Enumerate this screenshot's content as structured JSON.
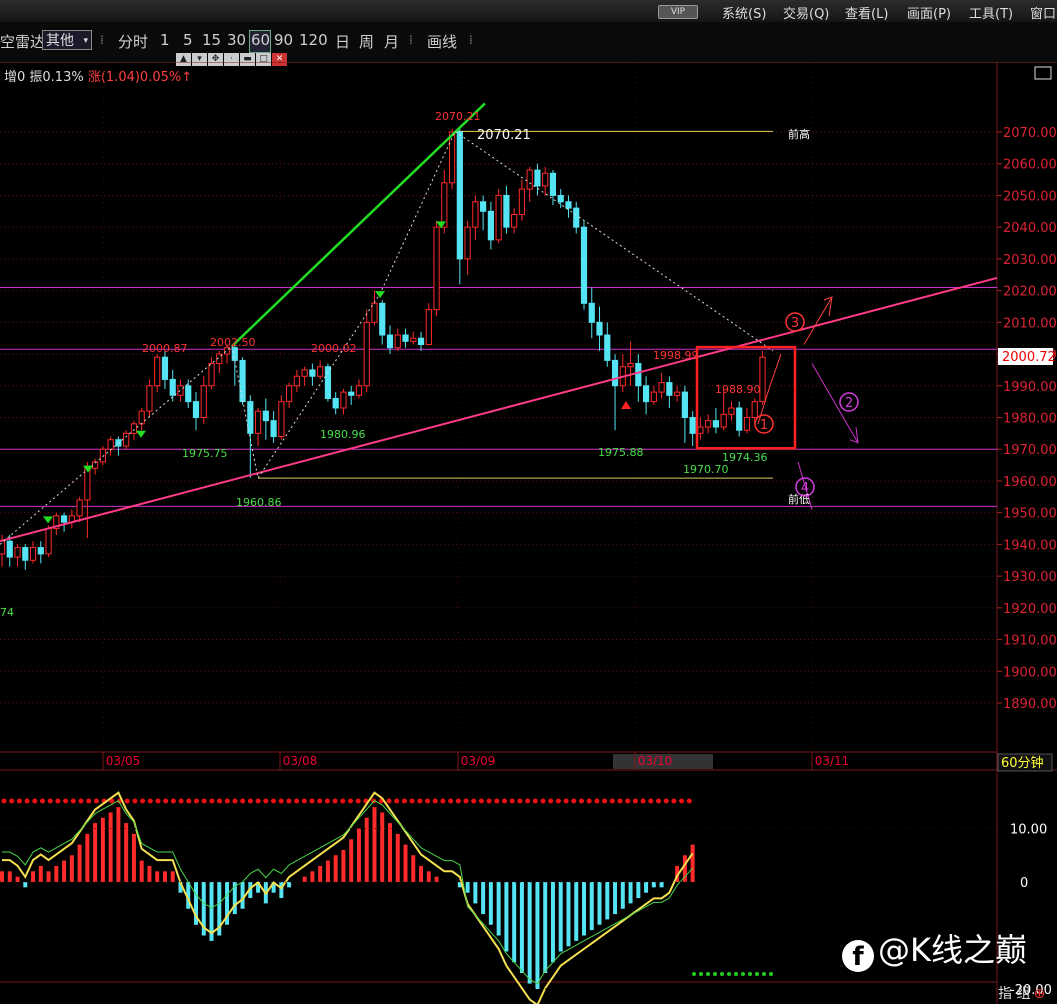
{
  "topbar": {
    "vip": "VIP",
    "menus": [
      "系统(S)",
      "交易(Q)",
      "查看(L)",
      "画面(P)",
      "工具(T)",
      "窗口"
    ]
  },
  "toolbar": {
    "left_label": "空雷达",
    "select_value": "其他",
    "periods": [
      "分时",
      "1",
      "5",
      "15",
      "30",
      "60",
      "90",
      "120",
      "日",
      "周",
      "月"
    ],
    "active_period": "60",
    "draw": "画线"
  },
  "info": {
    "part1": "增0 振0.13%",
    "part2": "涨(1.04)0.05%↑"
  },
  "current_price": "2000.72",
  "period_label": "60分钟",
  "indicator_label": "指 组",
  "brand": "@K线之巅",
  "colors": {
    "up": "#ff2a2a",
    "down": "#54e4f4",
    "trend_green": "#22dd22",
    "trend_pink": "#ff3a86",
    "level_purple": "#cc33cc",
    "box": "#ff2222"
  },
  "chart_data": [
    {
      "type": "candlestick",
      "ylim": [
        1885,
        2078
      ],
      "y_ticks": [
        "2070.00",
        "2060.00",
        "2050.00",
        "2040.00",
        "2030.00",
        "2020.00",
        "2010.00",
        "2000.00",
        "1990.00",
        "1980.00",
        "1970.00",
        "1960.00",
        "1950.00",
        "1940.00",
        "1930.00",
        "1920.00",
        "1910.00",
        "1900.00",
        "1890.00"
      ],
      "x_ticks": [
        "03/05",
        "03/08",
        "03/09",
        "03/10",
        "03/11"
      ],
      "candles": [
        [
          1937,
          1941,
          1933,
          1943
        ],
        [
          1941,
          1936,
          1933,
          1943
        ],
        [
          1936,
          1939,
          1933,
          1940
        ],
        [
          1939,
          1935,
          1932,
          1940
        ],
        [
          1935,
          1939,
          1934,
          1941
        ],
        [
          1939,
          1937,
          1934,
          1941
        ],
        [
          1937,
          1945,
          1936,
          1946
        ],
        [
          1945,
          1949,
          1943,
          1950
        ],
        [
          1949,
          1947,
          1944,
          1950
        ],
        [
          1947,
          1949,
          1945,
          1951
        ],
        [
          1949,
          1954,
          1947,
          1955
        ],
        [
          1954,
          1964,
          1942,
          1966
        ],
        [
          1964,
          1966,
          1962,
          1967
        ],
        [
          1966,
          1970,
          1965,
          1971
        ],
        [
          1970,
          1973,
          1968,
          1974
        ],
        [
          1973,
          1971,
          1968,
          1974
        ],
        [
          1971,
          1975,
          1970,
          1976
        ],
        [
          1975,
          1978,
          1973,
          1979
        ],
        [
          1978,
          1982,
          1976,
          1983
        ],
        [
          1982,
          1990,
          1980,
          1992
        ],
        [
          1990,
          1999,
          1988,
          2000
        ],
        [
          1999,
          1992,
          1989,
          2001
        ],
        [
          1992,
          1987,
          1985,
          1995
        ],
        [
          1987,
          1990,
          1985,
          1992
        ],
        [
          1990,
          1985,
          1983,
          1992
        ],
        [
          1985,
          1980,
          1976,
          1988
        ],
        [
          1980,
          1990,
          1978,
          1993
        ],
        [
          1990,
          1997,
          1989,
          1999
        ],
        [
          1997,
          2000,
          1994,
          2001
        ],
        [
          2000,
          2002,
          1997,
          2003
        ],
        [
          2002,
          1998,
          1990,
          2003
        ],
        [
          1998,
          1985,
          1984,
          1999
        ],
        [
          1985,
          1975,
          1961,
          1987
        ],
        [
          1975,
          1982,
          1971,
          1983
        ],
        [
          1982,
          1979,
          1973,
          1986
        ],
        [
          1979,
          1974,
          1972,
          1982
        ],
        [
          1974,
          1985,
          1973,
          1987
        ],
        [
          1985,
          1990,
          1983,
          1991
        ],
        [
          1990,
          1993,
          1988,
          1995
        ],
        [
          1993,
          1995,
          1990,
          1996
        ],
        [
          1995,
          1993,
          1990,
          1997
        ],
        [
          1993,
          1996,
          1992,
          1998
        ],
        [
          1996,
          1986,
          1985,
          1997
        ],
        [
          1986,
          1983,
          1981,
          1988
        ],
        [
          1983,
          1988,
          1981,
          1989
        ],
        [
          1988,
          1987,
          1984,
          1990
        ],
        [
          1987,
          1990,
          1986,
          1992
        ],
        [
          1990,
          2010,
          1988,
          2014
        ],
        [
          2010,
          2016,
          2009,
          2020
        ],
        [
          2016,
          2006,
          2003,
          2017
        ],
        [
          2006,
          2002,
          2000,
          2009
        ],
        [
          2002,
          2006,
          2001,
          2008
        ],
        [
          2006,
          2004,
          2002,
          2008
        ],
        [
          2004,
          2005,
          2003,
          2007
        ],
        [
          2005,
          2003,
          2001,
          2007
        ],
        [
          2003,
          2014,
          2003,
          2016
        ],
        [
          2014,
          2040,
          2012,
          2042
        ],
        [
          2040,
          2054,
          2038,
          2058
        ],
        [
          2054,
          2070,
          2052,
          2071
        ],
        [
          2070,
          2030,
          2022,
          2071
        ],
        [
          2030,
          2040,
          2025,
          2042
        ],
        [
          2040,
          2048,
          2036,
          2050
        ],
        [
          2048,
          2045,
          2039,
          2050
        ],
        [
          2045,
          2036,
          2033,
          2048
        ],
        [
          2036,
          2050,
          2035,
          2052
        ],
        [
          2050,
          2040,
          2038,
          2053
        ],
        [
          2040,
          2044,
          2038,
          2046
        ],
        [
          2044,
          2052,
          2042,
          2055
        ],
        [
          2052,
          2058,
          2048,
          2059
        ],
        [
          2058,
          2053,
          2050,
          2060
        ],
        [
          2053,
          2057,
          2050,
          2059
        ],
        [
          2057,
          2050,
          2047,
          2058
        ],
        [
          2050,
          2048,
          2046,
          2052
        ],
        [
          2048,
          2046,
          2043,
          2050
        ],
        [
          2046,
          2040,
          2038,
          2048
        ],
        [
          2040,
          2016,
          2014,
          2042
        ],
        [
          2016,
          2010,
          2005,
          2021
        ],
        [
          2010,
          2006,
          2001,
          2015
        ],
        [
          2006,
          1998,
          1996,
          2010
        ],
        [
          1998,
          1990,
          1976,
          2000
        ],
        [
          1990,
          1996,
          1988,
          2000
        ],
        [
          1996,
          1997,
          1990,
          2004
        ],
        [
          1997,
          1990,
          1985,
          2000
        ],
        [
          1990,
          1985,
          1981,
          1993
        ],
        [
          1985,
          1988,
          1984,
          1990
        ],
        [
          1988,
          1991,
          1986,
          1994
        ],
        [
          1991,
          1987,
          1983,
          1993
        ],
        [
          1987,
          1988,
          1985,
          1990
        ],
        [
          1988,
          1980,
          1972,
          1990
        ],
        [
          1980,
          1975,
          1971,
          1982
        ],
        [
          1975,
          1977,
          1973,
          1980
        ],
        [
          1977,
          1979,
          1975,
          1981
        ],
        [
          1979,
          1977,
          1975,
          1983
        ],
        [
          1977,
          1981,
          1976,
          1989
        ],
        [
          1981,
          1983,
          1979,
          1985
        ],
        [
          1983,
          1976,
          1974,
          1985
        ],
        [
          1976,
          1980,
          1975,
          1983
        ],
        [
          1980,
          1985,
          1978,
          1986
        ],
        [
          1985,
          1999,
          1984,
          2001
        ]
      ],
      "annotations": [
        {
          "text": "2070.21",
          "price": 2070.21,
          "color": "red"
        },
        {
          "text": "2070.21",
          "price": 2070.21,
          "color": "white"
        },
        {
          "text": "前高",
          "price": 2070
        },
        {
          "text": "2000.87",
          "price": 2000.87,
          "color": "red"
        },
        {
          "text": "2002.50",
          "price": 2002.5,
          "color": "red"
        },
        {
          "text": "2000.02",
          "price": 2000.02,
          "color": "red"
        },
        {
          "text": "1998.99",
          "price": 1998.99,
          "color": "red"
        },
        {
          "text": "1988.90",
          "price": 1988.9,
          "color": "red"
        },
        {
          "text": "1975.75",
          "price": 1975.75,
          "color": "green"
        },
        {
          "text": "1980.96",
          "price": 1980.96,
          "color": "green"
        },
        {
          "text": "1960.86",
          "price": 1960.86,
          "color": "green"
        },
        {
          "text": "1975.88",
          "price": 1975.88,
          "color": "green"
        },
        {
          "text": "1970.70",
          "price": 1970.7,
          "color": "green"
        },
        {
          "text": "1974.36",
          "price": 1974.36,
          "color": "green"
        },
        {
          "text": "前低",
          "price": 1960
        },
        {
          "text": "74",
          "price": 1931,
          "color": "green"
        }
      ],
      "levels": [
        2021,
        2001.5,
        1970,
        1952
      ],
      "markers": [
        "①",
        "②",
        "③",
        "④"
      ]
    },
    {
      "type": "macd",
      "ylim": [
        -21,
        22
      ],
      "y_ticks": [
        "10.00",
        "0",
        "-20.00"
      ],
      "histogram": [
        2,
        2,
        1,
        -1,
        2,
        3,
        2,
        3,
        4,
        5,
        7,
        9,
        11,
        12,
        13,
        14,
        11,
        9,
        4,
        3,
        2,
        2,
        2,
        -2,
        -5,
        -8,
        -10,
        -11,
        -10,
        -8,
        -6,
        -5,
        -3,
        -2,
        -4,
        -2,
        -3,
        -1,
        0,
        1,
        2,
        3,
        4,
        5,
        6,
        8,
        10,
        12,
        14,
        13,
        11,
        9,
        7,
        5,
        3,
        2,
        1,
        0,
        0,
        -1,
        -2,
        -4,
        -6,
        -8,
        -10,
        -13,
        -15,
        -17,
        -19,
        -20,
        -17,
        -15,
        -13,
        -12,
        -11,
        -10,
        -9,
        -8,
        -7,
        -6,
        -5,
        -4,
        -3,
        -2,
        -1,
        -1,
        0,
        3,
        5,
        7
      ]
    }
  ]
}
